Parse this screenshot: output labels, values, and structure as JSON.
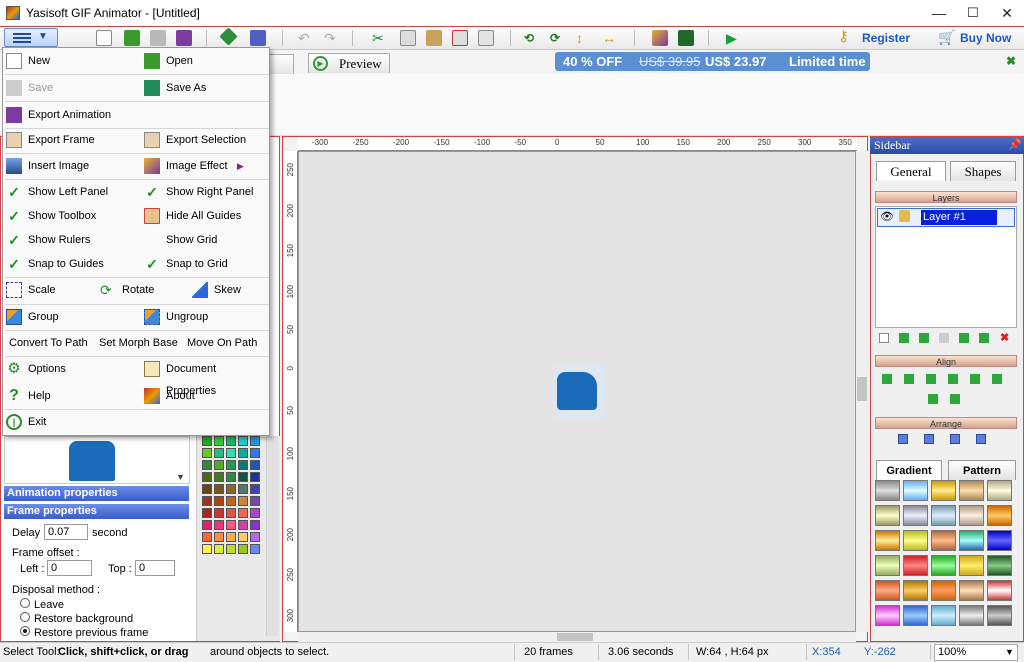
{
  "window": {
    "title": "Yasisoft GIF Animator - [Untitled]",
    "min": "—",
    "max": "☐",
    "close": "✕"
  },
  "toolbar": {
    "register": "Register",
    "buy_now": "Buy Now"
  },
  "tabs": {
    "preview": "Preview"
  },
  "promo": {
    "discount": "40 % OFF",
    "old_price": "US$ 39.95",
    "new_price": "US$ 23.97",
    "note": "Limited time"
  },
  "menu": {
    "new": "New",
    "open": "Open",
    "save": "Save",
    "save_as": "Save As",
    "export_animation": "Export Animation",
    "export_frame": "Export Frame",
    "export_selection": "Export Selection",
    "insert_image": "Insert Image",
    "image_effect": "Image Effect",
    "show_left_panel": "Show Left Panel",
    "show_right_panel": "Show Right Panel",
    "show_toolbox": "Show Toolbox",
    "hide_all_guides": "Hide All Guides",
    "show_rulers": "Show Rulers",
    "show_grid": "Show Grid",
    "snap_to_guides": "Snap to Guides",
    "snap_to_grid": "Snap to Grid",
    "scale": "Scale",
    "rotate": "Rotate",
    "skew": "Skew",
    "group": "Group",
    "ungroup": "Ungroup",
    "convert_to_path": "Convert To Path",
    "set_morph_base": "Set Morph Base",
    "move_on_path": "Move On Path",
    "options": "Options",
    "document_properties": "Document Properties",
    "help": "Help",
    "about": "About",
    "exit": "Exit"
  },
  "sidebar": {
    "title": "Sidebar",
    "tab_general": "General",
    "tab_shapes": "Shapes",
    "layers_label": "Layers",
    "layer_name": "Layer #1",
    "align_label": "Align",
    "arrange_label": "Arrange",
    "tab_gradient": "Gradient",
    "tab_pattern": "Pattern"
  },
  "props": {
    "animation_properties": "Animation properties",
    "frame_properties": "Frame properties",
    "delay_label": "Delay :",
    "delay_value": "0.07",
    "delay_unit": "second",
    "frame_offset": "Frame offset :",
    "left_label": "Left :",
    "left_value": "0",
    "top_label": "Top :",
    "top_value": "0",
    "disposal": "Disposal method :",
    "leave": "Leave",
    "restore_bg": "Restore background",
    "restore_prev": "Restore previous frame"
  },
  "status": {
    "prefix": "Select Tool:",
    "bold": "Click, shift+click, or drag",
    "suffix": "around objects to select.",
    "frames": "20 frames",
    "seconds": "3.06 seconds",
    "size": "W:64 , H:64 px",
    "x": "X:354",
    "y": "Y:-262",
    "zoom": "100%"
  },
  "ruler_h": [
    "-300",
    "-250",
    "-200",
    "-150",
    "-100",
    "-50",
    "0",
    "50",
    "100",
    "150",
    "200",
    "250",
    "300",
    "350"
  ],
  "ruler_v": [
    "250",
    "200",
    "150",
    "100",
    "50",
    "0",
    "50",
    "100",
    "150",
    "200",
    "250",
    "300"
  ],
  "colors": {
    "accent": "#c44444",
    "link": "#1b59c7",
    "promo": "#5b8fd3",
    "panel_bar": "#3a5ccd"
  }
}
